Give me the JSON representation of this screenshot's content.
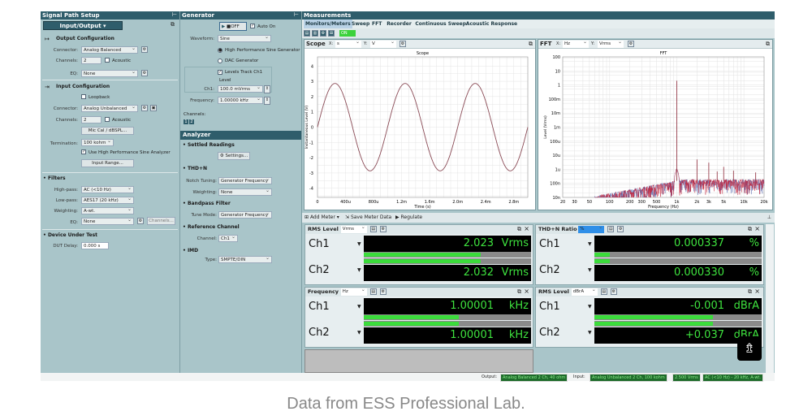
{
  "signal_path": {
    "title": "Signal Path Setup",
    "selector": "Input/Output",
    "output": {
      "title": "Output Configuration",
      "connector_label": "Connector:",
      "connector": "Analog Balanced",
      "channels_label": "Channels:",
      "channels": "2",
      "acoustic": "Acoustic",
      "eq_label": "EQ:",
      "eq": "None"
    },
    "input": {
      "title": "Input Configuration",
      "loopback": "Loopback",
      "connector_label": "Connector:",
      "connector": "Analog Unbalanced",
      "channels_label": "Channels:",
      "channels": "2",
      "acoustic": "Acoustic",
      "mic_cal": "Mic Cal / dBSPL...",
      "termination_label": "Termination:",
      "termination": "100 kohm",
      "use_hp": "Use High Performance Sine Analyzer",
      "use_hp_checked": true,
      "input_range": "Input Range..."
    },
    "filters": {
      "title": "Filters",
      "highpass_label": "High-pass:",
      "highpass": "AC (<10 Hz)",
      "lowpass_label": "Low-pass:",
      "lowpass": "AES17 (20 kHz)",
      "weighting_label": "Weighting:",
      "weighting": "A-wt.",
      "eq_label": "EQ:",
      "eq": "None",
      "channels_btn": "Channels..."
    },
    "dut": {
      "title": "Device Under Test",
      "delay_label": "DUT Delay:",
      "delay": "0.000 s"
    }
  },
  "generator": {
    "title": "Generator",
    "off": "OFF",
    "auto_on": "Auto On",
    "waveform_label": "Waveform:",
    "waveform": "Sine",
    "hp_sine": "High Performance Sine Generator",
    "dac": "DAC Generator",
    "levels_track": "Levels Track Ch1",
    "level": "Level",
    "ch1_label": "Ch1:",
    "ch1": "100.0 mVrms",
    "frequency_label": "Frequency:",
    "frequency": "1.00000 kHz",
    "channels_label": "Channels:",
    "ch_buttons": [
      "1",
      "2"
    ]
  },
  "analyzer": {
    "title": "Analyzer",
    "settled": "Settled Readings",
    "settings": "Settings...",
    "thdn": "THD+N",
    "notch_label": "Notch Tuning:",
    "notch": "Generator Frequency",
    "weighting_label": "Weighting:",
    "weighting": "None",
    "bandpass": "Bandpass Filter",
    "tune_label": "Tune Mode:",
    "tune": "Generator Frequency",
    "ref": "Reference Channel",
    "channel_label": "Channel:",
    "channel": "Ch1",
    "imd": "IMD",
    "type_label": "Type:",
    "type": "SMPTE/DIN"
  },
  "measurements": {
    "title": "Measurements",
    "tabs": [
      "Monitors/Meters",
      "Sweep",
      "FFT",
      "Recorder",
      "Continuous Sweep",
      "Acoustic Response"
    ],
    "on": "ON",
    "toolbar": {
      "add_meter": "Add Meter",
      "save": "Save Meter Data",
      "regulate": "Regulate"
    }
  },
  "scope": {
    "title": "Scope",
    "x_unit": "s",
    "y_unit": "V",
    "chart_title": "Scope",
    "xlabel": "Time (s)",
    "ylabel": "Instantaneous Level (V)",
    "xticks": [
      "0",
      "400u",
      "800u",
      "1.2m",
      "1.6m",
      "2.0m",
      "2.4m",
      "2.8m"
    ],
    "yticks": [
      "4",
      "3",
      "2",
      "1",
      "0",
      "-1",
      "-2",
      "-3",
      "-4"
    ],
    "xlim": [
      0,
      0.003
    ],
    "ylim": [
      -4.6,
      4.6
    ],
    "amplitude_v": 2.86,
    "frequency_hz": 1000
  },
  "fft": {
    "title": "FFT",
    "x_unit": "Hz",
    "y_unit": "Vrms",
    "chart_title": "FFT",
    "xlabel": "Frequency (Hz)",
    "ylabel": "Level (Vrms)",
    "xticks": [
      "20",
      "30",
      "50",
      "100",
      "200",
      "300",
      "500",
      "1k",
      "2k",
      "3k",
      "5k",
      "10k",
      "20k"
    ],
    "yticks": [
      "100",
      "10",
      "1",
      "100m",
      "10m",
      "1m",
      "100u",
      "10u",
      "1u",
      "100n",
      "10n"
    ],
    "xlim": [
      20,
      20000
    ],
    "ylim": [
      1e-08,
      100
    ],
    "x_scale": "log",
    "y_scale": "log",
    "peaks": [
      {
        "f": 1000,
        "v": 2.0
      },
      {
        "f": 2000,
        "v": 5e-06
      },
      {
        "f": 3000,
        "v": 3e-06
      },
      {
        "f": 5000,
        "v": 1.5e-06
      },
      {
        "f": 4000,
        "v": 7e-07
      },
      {
        "f": 7000,
        "v": 8e-07
      },
      {
        "f": 15000,
        "v": 6e-07
      }
    ],
    "series_colors": [
      "#3b4fa0",
      "#c0203a"
    ]
  },
  "meters": [
    {
      "title": "RMS Level",
      "unit_sel": "Vrms",
      "rows": [
        {
          "ch": "Ch1",
          "value": "2.023",
          "unit": "Vrms",
          "fill": 0.7
        },
        {
          "ch": "Ch2",
          "value": "2.032",
          "unit": "Vrms",
          "fill": 0.7
        }
      ]
    },
    {
      "title": "THD+N Ratio",
      "unit_sel": "%",
      "rows": [
        {
          "ch": "Ch1",
          "value": "0.000337",
          "unit": "%",
          "fill": 0.09
        },
        {
          "ch": "Ch2",
          "value": "0.000330",
          "unit": "%",
          "fill": 0.09
        }
      ]
    },
    {
      "title": "Frequency",
      "unit_sel": "Hz",
      "rows": [
        {
          "ch": "Ch1",
          "value": "1.00001",
          "unit": "kHz",
          "fill": 0.57
        },
        {
          "ch": "Ch2",
          "value": "1.00001",
          "unit": "kHz",
          "fill": 0.57
        }
      ]
    },
    {
      "title": "RMS Level",
      "unit_sel": "dBrA",
      "rows": [
        {
          "ch": "Ch1",
          "value": "-0.001",
          "unit": "dBrA",
          "fill": 0.71
        },
        {
          "ch": "Ch2",
          "value": "+0.037",
          "unit": "dBrA",
          "fill": 0.71
        }
      ]
    }
  ],
  "statusbar": {
    "output_label": "Output:",
    "output": "Analog Balanced 2 Ch, 40 ohm",
    "input_label": "Input:",
    "input": "Analog Unbalanced 2 Ch, 100 kohm",
    "range": "2.500 Vrms",
    "filter": "AC (<10 Hz) - 20 kHz, A-wt."
  },
  "caption": "Data from ESS Professional Lab."
}
